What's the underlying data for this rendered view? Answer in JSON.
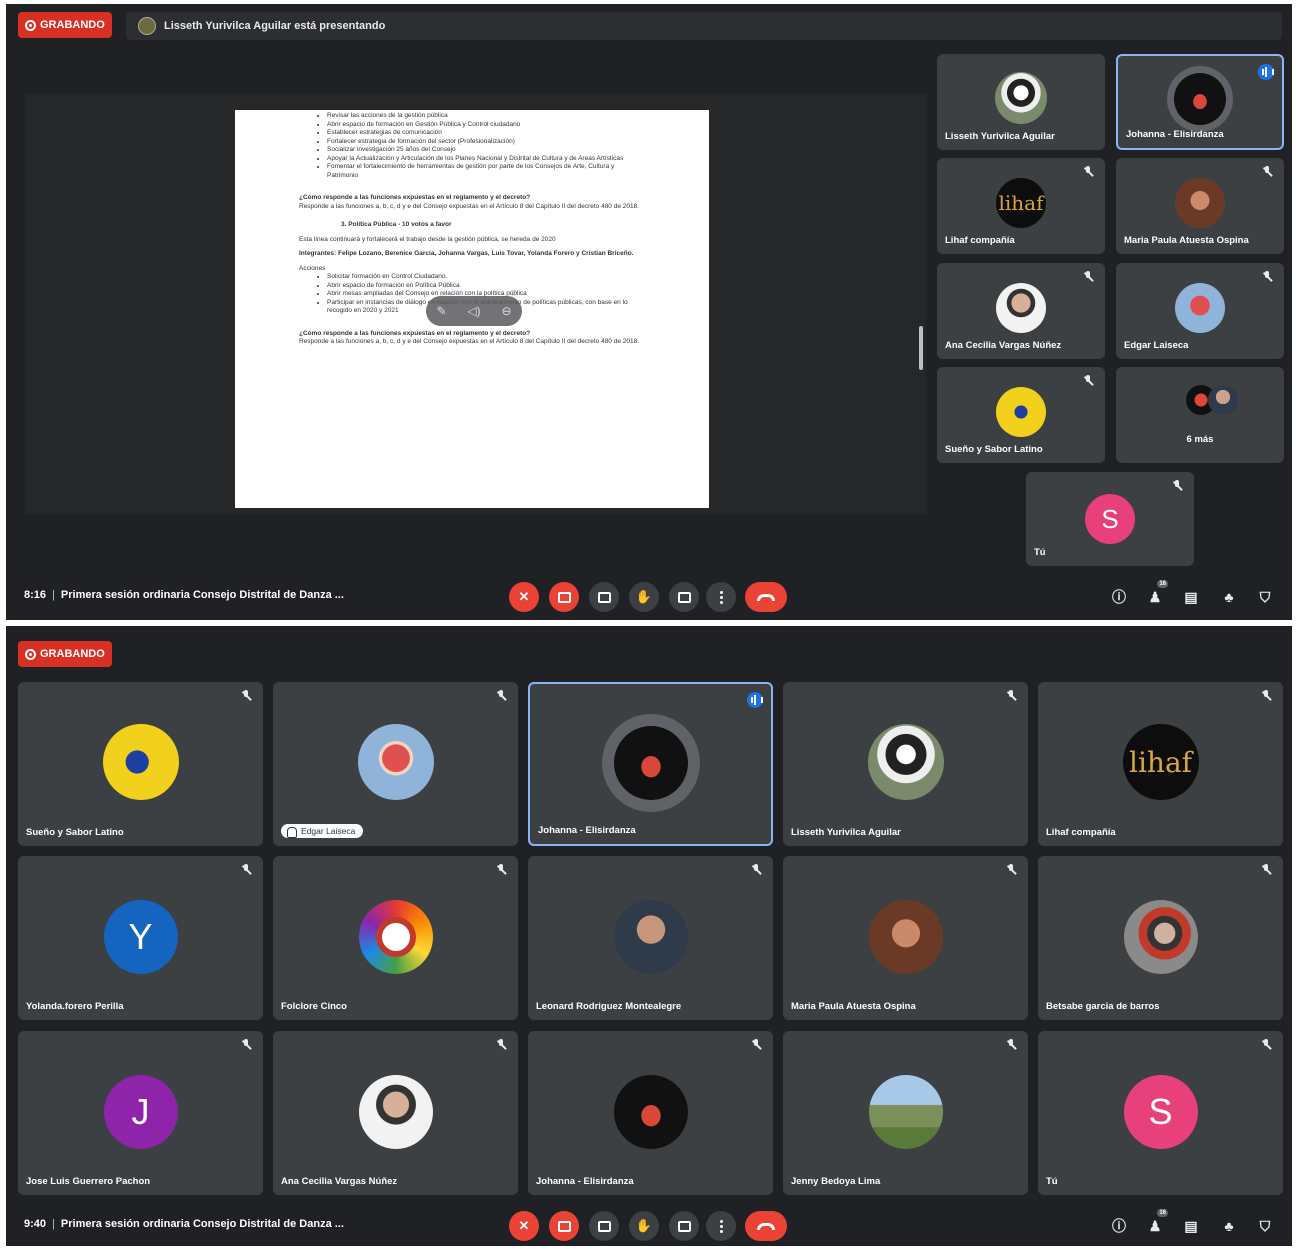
{
  "top": {
    "recording_label": "GRABANDO",
    "presenting_text": "Lisseth Yurivilca Aguilar está presentando",
    "document": {
      "bullets_1": [
        "Revisar las acciones de la gestión pública",
        "Abrir espacio de formación en Gestión Pública y Control ciudadano",
        "Establecer estrategias de comunicación",
        "Fortalecer estrategia de formación del sector (Profesionalización)",
        "Socializar investigación 25 años del Consejo",
        "Apoyar la Actualización y Articulación de los Planes Nacional y Distrital de Cultura y de Areas Artísticas",
        "Fomentar el fortalecimiento de herramientas de gestión por parte de los Consejos de Arte, Cultura y Patrimonio"
      ],
      "question_1": "¿Cómo responde a las funciones expuestas en el reglamento y el decreto?",
      "answer_1": "Responde a las funciones a, b, c, d y e del Consejo expuestas en el Artículo 8 del Capítulo II del decreto 480 de 2018.",
      "section_title": "3.   Política Pública - 10 votos a favor",
      "section_intro": "Esta línea continuará y fortalecerá el trabajo desde la gestión pública, se hereda de 2020",
      "members": "Integrantes: Felipe Lozano, Berenice García, Johanna Vargas, Luis Tovar, Yolanda Forero y Cristian Briceño.",
      "actions_label": "Acciones",
      "bullets_2": [
        "Solicitar formación en Control Ciudadano.",
        "Abrir espacio de formación en Política Pública",
        "Abrir mesas ampliadas del Consejo en relación con la política pública",
        "Participar en instancias de diálogo en relación con el planteamiento de políticas públicas, con base en lo recogido en 2020 y 2021"
      ],
      "question_2": "¿Cómo responde a las funciones expuestas en el reglamento y el decreto?",
      "answer_2": "Responde a las funciones a, b, c, d y e del Consejo expuestas en el Artículo 8 del Capítulo II del decreto 480 de 2018."
    },
    "tiles": [
      {
        "name": "Lisseth Yurivilca Aguilar",
        "avatar": "dog-avatar",
        "muted": false,
        "speaking": false
      },
      {
        "name": "Johanna - Elisirdanza",
        "avatar": "dancer-avatar",
        "muted": false,
        "speaking": true
      },
      {
        "name": "Lihaf compañía",
        "avatar": "lihaf-logo",
        "muted": true,
        "speaking": false
      },
      {
        "name": "Maria Paula Atuesta Ospina",
        "avatar": "portrait-avatar",
        "muted": true,
        "speaking": false
      },
      {
        "name": "Ana Cecilia Vargas Núñez",
        "avatar": "portrait-avatar",
        "muted": true,
        "speaking": false
      },
      {
        "name": "Edgar Laiseca",
        "avatar": "portrait-avatar",
        "muted": true,
        "speaking": false
      },
      {
        "name": "Sueño y Sabor Latino",
        "avatar": "sueno-logo",
        "muted": true,
        "speaking": false
      },
      {
        "name": "6 más",
        "avatar": "group-avatar",
        "muted": false,
        "speaking": false
      }
    ],
    "self_tile": {
      "name": "Tú",
      "initial": "S"
    },
    "bar": {
      "time": "8:16",
      "meeting_title": "Primera sesión ordinaria Consejo Distrital de Danza ...",
      "participants_count": "16"
    }
  },
  "bottom": {
    "recording_label": "GRABANDO",
    "tiles": [
      {
        "name": "Sueño y Sabor Latino",
        "avatar": "sueno-logo",
        "muted": true,
        "speaking": false
      },
      {
        "name": "Edgar Laiseca",
        "avatar": "portrait-avatar",
        "muted": true,
        "speaking": false,
        "pill": true
      },
      {
        "name": "Johanna - Elisirdanza",
        "avatar": "dancer-avatar",
        "muted": false,
        "speaking": true
      },
      {
        "name": "Lisseth Yurivilca Aguilar",
        "avatar": "dog-avatar",
        "muted": true,
        "speaking": false
      },
      {
        "name": "Lihaf compañía",
        "avatar": "lihaf-logo",
        "muted": true,
        "speaking": false
      },
      {
        "name": "Yolanda.forero Perilla",
        "avatar": "initial",
        "initial": "Y",
        "color": "#1565c0",
        "muted": true,
        "speaking": false
      },
      {
        "name": "Folclore Cinco",
        "avatar": "folclore-logo",
        "muted": true,
        "speaking": false
      },
      {
        "name": "Leonard Rodriguez Montealegre",
        "avatar": "portrait-avatar",
        "muted": true,
        "speaking": false
      },
      {
        "name": "Maria Paula Atuesta Ospina",
        "avatar": "portrait-avatar",
        "muted": true,
        "speaking": false
      },
      {
        "name": "Betsabe garcia de barros",
        "avatar": "portrait-avatar",
        "muted": true,
        "speaking": false
      },
      {
        "name": "Jose Luis Guerrero Pachon",
        "avatar": "initial",
        "initial": "J",
        "color": "#8e24aa",
        "muted": true,
        "speaking": false
      },
      {
        "name": "Ana Cecilia Vargas Núñez",
        "avatar": "portrait-avatar",
        "muted": true,
        "speaking": false
      },
      {
        "name": "Johanna - Elisirdanza",
        "avatar": "dancer-avatar",
        "muted": true,
        "speaking": false
      },
      {
        "name": "Jenny Bedoya Lima",
        "avatar": "landscape-avatar",
        "muted": true,
        "speaking": false
      },
      {
        "name": "Tú",
        "avatar": "initial",
        "initial": "S",
        "color": "#e8407a",
        "muted": true,
        "speaking": false
      }
    ],
    "bar": {
      "time": "9:40",
      "meeting_title": "Primera sesión ordinaria Consejo Distrital de Danza ...",
      "participants_count": "16"
    }
  },
  "colors": {
    "recording": "#d93025",
    "background": "#202124",
    "tile": "#3c4043",
    "active_border": "#8ab4f8",
    "hangup": "#ea4335",
    "self_avatar": "#e8407a"
  }
}
